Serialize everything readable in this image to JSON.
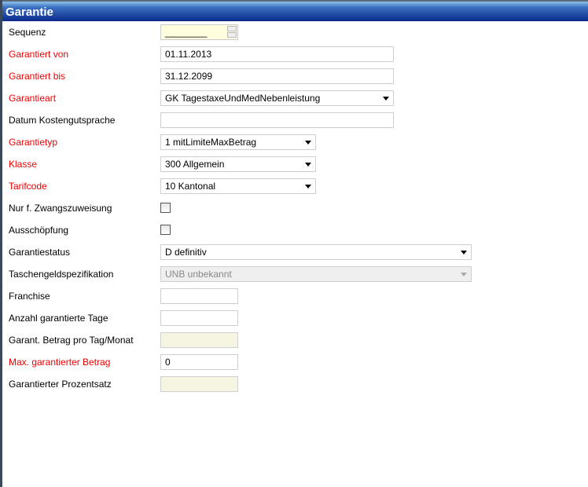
{
  "title": "Garantie",
  "fields": [
    {
      "label": "Sequenz",
      "required": false,
      "type": "spinner",
      "value": "________"
    },
    {
      "label": "Garantiert von",
      "required": true,
      "type": "text",
      "value": "01.11.2013"
    },
    {
      "label": "Garantiert bis",
      "required": true,
      "type": "text",
      "value": "31.12.2099"
    },
    {
      "label": "Garantieart",
      "required": true,
      "type": "select",
      "value": "GK TagestaxeUndMedNebenleistung"
    },
    {
      "label": "Datum Kostengutsprache",
      "required": false,
      "type": "text",
      "value": ""
    },
    {
      "label": "Garantietyp",
      "required": true,
      "type": "select",
      "value": "1 mitLimiteMaxBetrag"
    },
    {
      "label": "Klasse",
      "required": true,
      "type": "select",
      "value": "300 Allgemein"
    },
    {
      "label": "Tarifcode",
      "required": true,
      "type": "select",
      "value": "10 Kantonal"
    },
    {
      "label": "Nur f. Zwangszuweisung",
      "required": false,
      "type": "checkbox",
      "value": ""
    },
    {
      "label": "Ausschöpfung",
      "required": false,
      "type": "checkbox",
      "value": ""
    },
    {
      "label": "Garantiestatus",
      "required": false,
      "type": "select",
      "value": "D definitiv"
    },
    {
      "label": "Taschengeldspezifikation",
      "required": false,
      "type": "select-disabled",
      "value": "UNB unbekannt"
    },
    {
      "label": "Franchise",
      "required": false,
      "type": "text",
      "value": ""
    },
    {
      "label": "Anzahl garantierte Tage",
      "required": false,
      "type": "text",
      "value": ""
    },
    {
      "label": "Garant. Betrag pro Tag/Monat",
      "required": false,
      "type": "readonly",
      "value": ""
    },
    {
      "label": "Max. garantierter Betrag",
      "required": true,
      "type": "text",
      "value": "0"
    },
    {
      "label": "Garantierter Prozentsatz",
      "required": false,
      "type": "readonly",
      "value": ""
    }
  ]
}
